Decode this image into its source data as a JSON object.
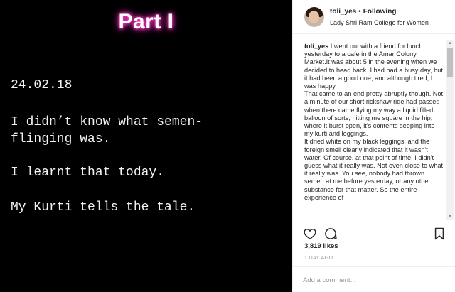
{
  "image": {
    "title": "Part I",
    "date": "24.02.18",
    "lines": [
      "I didn’t know what semen-",
      "flinging was.",
      "I learnt that today.",
      "My Kurti tells the tale."
    ]
  },
  "header": {
    "username": "toli_yes",
    "separator": "•",
    "follow_status": "Following",
    "location": "Lady Shri Ram College for Women"
  },
  "caption": {
    "username": "toli_yes",
    "paragraphs": [
      "I went out with a friend for lunch yesterday to a cafe in the Amar Colony Market.It was about 5 in the evening when we decided to head back. I had had a busy day, but it had been a good one, and although tired, I was happy.",
      "That came to an end pretty abruptly though. Not a minute of our short rickshaw ride had passed when there came flying my way a liquid filled balloon of sorts, hitting me square in the hip, where it burst open, it's contents seeping into my kurti and leggings.",
      "It dried white on my black leggings, and the foreign smell clearly indicated that it wasn't water. Of course, at that point of time, I didn't guess what it really was. Not even close to what it really was. You see, nobody had thrown semen at me before yesterday, or any other substance for that matter. So the entire experience of"
    ]
  },
  "icons": {
    "like": "heart-icon",
    "comment": "comment-icon",
    "save": "bookmark-icon"
  },
  "stats": {
    "likes": "3,819 likes",
    "timestamp": "1 DAY AGO"
  },
  "comment_box": {
    "placeholder": "Add a comment..."
  },
  "colors": {
    "title_glow": "#ff3fc4",
    "image_bg": "#000000",
    "text_dark": "#262626",
    "text_muted": "#999999"
  }
}
